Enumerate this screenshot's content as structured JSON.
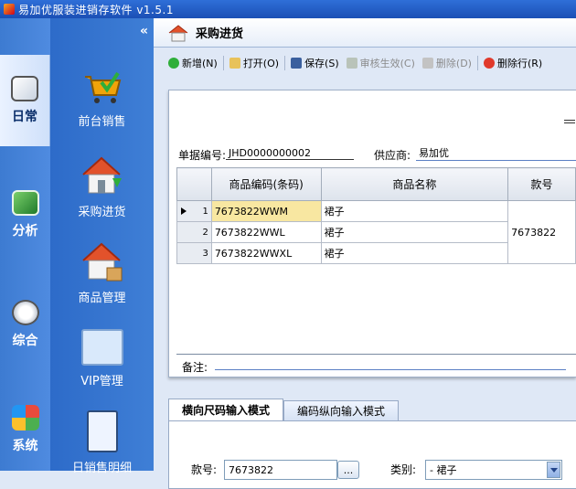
{
  "window": {
    "title": "易加优服装进销存软件 v1.5.1"
  },
  "sidebar": {
    "collapse": "«",
    "categories": [
      {
        "label": "日常",
        "icon": "clock-icon"
      },
      {
        "label": "分析",
        "icon": "chart-icon"
      },
      {
        "label": "综合",
        "icon": "timer-icon"
      },
      {
        "label": "系统",
        "icon": "windows-icon"
      }
    ],
    "modules": [
      {
        "label": "前台销售",
        "icon": "cart-icon"
      },
      {
        "label": "采购进货",
        "icon": "house-download-icon"
      },
      {
        "label": "商品管理",
        "icon": "house-box-icon"
      },
      {
        "label": "VIP管理",
        "icon": "vip-card-icon"
      },
      {
        "label": "日销售明细",
        "icon": "clipboard-icon"
      }
    ]
  },
  "page": {
    "title": "采购进货"
  },
  "toolbar": [
    {
      "label": "新增(N)",
      "enabled": true,
      "icon": "add-icon"
    },
    {
      "label": "打开(O)",
      "enabled": true,
      "icon": "open-icon"
    },
    {
      "label": "保存(S)",
      "enabled": true,
      "icon": "save-icon"
    },
    {
      "label": "审核生效(C)",
      "enabled": false,
      "icon": "check-icon"
    },
    {
      "label": "删除(D)",
      "enabled": false,
      "icon": "delete-icon"
    },
    {
      "label": "删除行(R)",
      "enabled": true,
      "icon": "delete-row-icon"
    }
  ],
  "form": {
    "doc_no_label": "单据编号:",
    "doc_no_value": "JHD0000000002",
    "supplier_label": "供应商:",
    "supplier_value": "易加优",
    "remark_label": "备注:",
    "remark_value": ""
  },
  "grid": {
    "columns": [
      "商品编码(条码)",
      "商品名称",
      "款号"
    ],
    "rows": [
      {
        "num": "1",
        "code": "7673822WWM",
        "name": "裙子"
      },
      {
        "num": "2",
        "code": "7673822WWL",
        "name": "裙子"
      },
      {
        "num": "3",
        "code": "7673822WWXL",
        "name": "裙子"
      }
    ],
    "style_no": "7673822"
  },
  "lower": {
    "tabs": [
      "横向尺码输入模式",
      "编码纵向输入模式"
    ],
    "style_label": "款号:",
    "style_value": "7673822",
    "browse": "...",
    "category_label": "类别:",
    "category_value": "- 裙子"
  }
}
